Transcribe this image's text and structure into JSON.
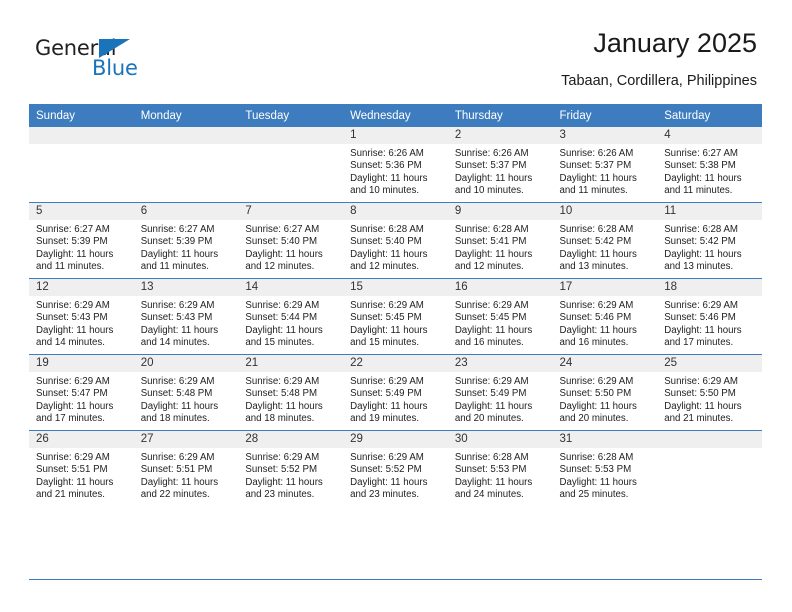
{
  "brand": {
    "name_part1": "General",
    "name_part2": "Blue",
    "triangle_color": "#1a74bb"
  },
  "header": {
    "title": "January 2025",
    "subtitle": "Tabaan, Cordillera, Philippines",
    "accent_color": "#3d7cbf",
    "band_color": "#efefef"
  },
  "calendar": {
    "weekdays": [
      "Sunday",
      "Monday",
      "Tuesday",
      "Wednesday",
      "Thursday",
      "Friday",
      "Saturday"
    ],
    "labels": {
      "sunrise": "Sunrise:",
      "sunset": "Sunset:",
      "daylight": "Daylight:"
    },
    "weeks": [
      [
        {
          "day": "",
          "empty": true
        },
        {
          "day": "",
          "empty": true
        },
        {
          "day": "",
          "empty": true
        },
        {
          "day": "1",
          "sunrise": "Sunrise: 6:26 AM",
          "sunset": "Sunset: 5:36 PM",
          "daylight_1": "Daylight: 11 hours",
          "daylight_2": "and 10 minutes."
        },
        {
          "day": "2",
          "sunrise": "Sunrise: 6:26 AM",
          "sunset": "Sunset: 5:37 PM",
          "daylight_1": "Daylight: 11 hours",
          "daylight_2": "and 10 minutes."
        },
        {
          "day": "3",
          "sunrise": "Sunrise: 6:26 AM",
          "sunset": "Sunset: 5:37 PM",
          "daylight_1": "Daylight: 11 hours",
          "daylight_2": "and 11 minutes."
        },
        {
          "day": "4",
          "sunrise": "Sunrise: 6:27 AM",
          "sunset": "Sunset: 5:38 PM",
          "daylight_1": "Daylight: 11 hours",
          "daylight_2": "and 11 minutes."
        }
      ],
      [
        {
          "day": "5",
          "sunrise": "Sunrise: 6:27 AM",
          "sunset": "Sunset: 5:39 PM",
          "daylight_1": "Daylight: 11 hours",
          "daylight_2": "and 11 minutes."
        },
        {
          "day": "6",
          "sunrise": "Sunrise: 6:27 AM",
          "sunset": "Sunset: 5:39 PM",
          "daylight_1": "Daylight: 11 hours",
          "daylight_2": "and 11 minutes."
        },
        {
          "day": "7",
          "sunrise": "Sunrise: 6:27 AM",
          "sunset": "Sunset: 5:40 PM",
          "daylight_1": "Daylight: 11 hours",
          "daylight_2": "and 12 minutes."
        },
        {
          "day": "8",
          "sunrise": "Sunrise: 6:28 AM",
          "sunset": "Sunset: 5:40 PM",
          "daylight_1": "Daylight: 11 hours",
          "daylight_2": "and 12 minutes."
        },
        {
          "day": "9",
          "sunrise": "Sunrise: 6:28 AM",
          "sunset": "Sunset: 5:41 PM",
          "daylight_1": "Daylight: 11 hours",
          "daylight_2": "and 12 minutes."
        },
        {
          "day": "10",
          "sunrise": "Sunrise: 6:28 AM",
          "sunset": "Sunset: 5:42 PM",
          "daylight_1": "Daylight: 11 hours",
          "daylight_2": "and 13 minutes."
        },
        {
          "day": "11",
          "sunrise": "Sunrise: 6:28 AM",
          "sunset": "Sunset: 5:42 PM",
          "daylight_1": "Daylight: 11 hours",
          "daylight_2": "and 13 minutes."
        }
      ],
      [
        {
          "day": "12",
          "sunrise": "Sunrise: 6:29 AM",
          "sunset": "Sunset: 5:43 PM",
          "daylight_1": "Daylight: 11 hours",
          "daylight_2": "and 14 minutes."
        },
        {
          "day": "13",
          "sunrise": "Sunrise: 6:29 AM",
          "sunset": "Sunset: 5:43 PM",
          "daylight_1": "Daylight: 11 hours",
          "daylight_2": "and 14 minutes."
        },
        {
          "day": "14",
          "sunrise": "Sunrise: 6:29 AM",
          "sunset": "Sunset: 5:44 PM",
          "daylight_1": "Daylight: 11 hours",
          "daylight_2": "and 15 minutes."
        },
        {
          "day": "15",
          "sunrise": "Sunrise: 6:29 AM",
          "sunset": "Sunset: 5:45 PM",
          "daylight_1": "Daylight: 11 hours",
          "daylight_2": "and 15 minutes."
        },
        {
          "day": "16",
          "sunrise": "Sunrise: 6:29 AM",
          "sunset": "Sunset: 5:45 PM",
          "daylight_1": "Daylight: 11 hours",
          "daylight_2": "and 16 minutes."
        },
        {
          "day": "17",
          "sunrise": "Sunrise: 6:29 AM",
          "sunset": "Sunset: 5:46 PM",
          "daylight_1": "Daylight: 11 hours",
          "daylight_2": "and 16 minutes."
        },
        {
          "day": "18",
          "sunrise": "Sunrise: 6:29 AM",
          "sunset": "Sunset: 5:46 PM",
          "daylight_1": "Daylight: 11 hours",
          "daylight_2": "and 17 minutes."
        }
      ],
      [
        {
          "day": "19",
          "sunrise": "Sunrise: 6:29 AM",
          "sunset": "Sunset: 5:47 PM",
          "daylight_1": "Daylight: 11 hours",
          "daylight_2": "and 17 minutes."
        },
        {
          "day": "20",
          "sunrise": "Sunrise: 6:29 AM",
          "sunset": "Sunset: 5:48 PM",
          "daylight_1": "Daylight: 11 hours",
          "daylight_2": "and 18 minutes."
        },
        {
          "day": "21",
          "sunrise": "Sunrise: 6:29 AM",
          "sunset": "Sunset: 5:48 PM",
          "daylight_1": "Daylight: 11 hours",
          "daylight_2": "and 18 minutes."
        },
        {
          "day": "22",
          "sunrise": "Sunrise: 6:29 AM",
          "sunset": "Sunset: 5:49 PM",
          "daylight_1": "Daylight: 11 hours",
          "daylight_2": "and 19 minutes."
        },
        {
          "day": "23",
          "sunrise": "Sunrise: 6:29 AM",
          "sunset": "Sunset: 5:49 PM",
          "daylight_1": "Daylight: 11 hours",
          "daylight_2": "and 20 minutes."
        },
        {
          "day": "24",
          "sunrise": "Sunrise: 6:29 AM",
          "sunset": "Sunset: 5:50 PM",
          "daylight_1": "Daylight: 11 hours",
          "daylight_2": "and 20 minutes."
        },
        {
          "day": "25",
          "sunrise": "Sunrise: 6:29 AM",
          "sunset": "Sunset: 5:50 PM",
          "daylight_1": "Daylight: 11 hours",
          "daylight_2": "and 21 minutes."
        }
      ],
      [
        {
          "day": "26",
          "sunrise": "Sunrise: 6:29 AM",
          "sunset": "Sunset: 5:51 PM",
          "daylight_1": "Daylight: 11 hours",
          "daylight_2": "and 21 minutes."
        },
        {
          "day": "27",
          "sunrise": "Sunrise: 6:29 AM",
          "sunset": "Sunset: 5:51 PM",
          "daylight_1": "Daylight: 11 hours",
          "daylight_2": "and 22 minutes."
        },
        {
          "day": "28",
          "sunrise": "Sunrise: 6:29 AM",
          "sunset": "Sunset: 5:52 PM",
          "daylight_1": "Daylight: 11 hours",
          "daylight_2": "and 23 minutes."
        },
        {
          "day": "29",
          "sunrise": "Sunrise: 6:29 AM",
          "sunset": "Sunset: 5:52 PM",
          "daylight_1": "Daylight: 11 hours",
          "daylight_2": "and 23 minutes."
        },
        {
          "day": "30",
          "sunrise": "Sunrise: 6:28 AM",
          "sunset": "Sunset: 5:53 PM",
          "daylight_1": "Daylight: 11 hours",
          "daylight_2": "and 24 minutes."
        },
        {
          "day": "31",
          "sunrise": "Sunrise: 6:28 AM",
          "sunset": "Sunset: 5:53 PM",
          "daylight_1": "Daylight: 11 hours",
          "daylight_2": "and 25 minutes."
        },
        {
          "day": "",
          "empty": true
        }
      ]
    ]
  }
}
